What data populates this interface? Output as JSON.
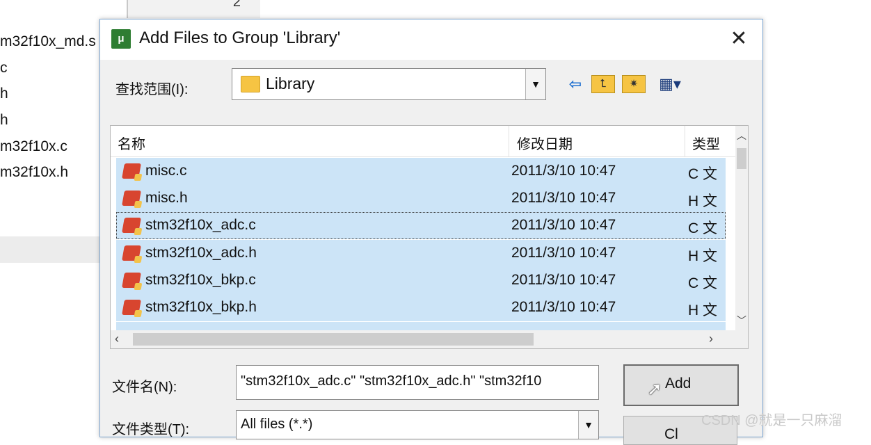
{
  "background": {
    "line_number": "2",
    "items": [
      "m32f10x_md.s",
      "c",
      "h",
      "h",
      "m32f10x.c",
      "m32f10x.h"
    ]
  },
  "dialog": {
    "title": "Add Files to Group 'Library'",
    "close_glyph": "✕",
    "lookin_label": "查找范围(I):",
    "lookin_value": "Library",
    "toolbar": {
      "back_glyph": "⇦",
      "up_glyph": "⮤",
      "new_folder_glyph": "✷",
      "view_glyph": "▦▾"
    },
    "columns": {
      "name": "名称",
      "date": "修改日期",
      "type": "类型"
    },
    "files": [
      {
        "name": "misc.c",
        "date": "2011/3/10 10:47",
        "type": "C 文"
      },
      {
        "name": "misc.h",
        "date": "2011/3/10 10:47",
        "type": "H 文"
      },
      {
        "name": "stm32f10x_adc.c",
        "date": "2011/3/10 10:47",
        "type": "C 文"
      },
      {
        "name": "stm32f10x_adc.h",
        "date": "2011/3/10 10:47",
        "type": "H 文"
      },
      {
        "name": "stm32f10x_bkp.c",
        "date": "2011/3/10 10:47",
        "type": "C 文"
      },
      {
        "name": "stm32f10x_bkp.h",
        "date": "2011/3/10 10:47",
        "type": "H 文"
      }
    ],
    "filename_label": "文件名(N):",
    "filename_value": "\"stm32f10x_adc.c\" \"stm32f10x_adc.h\" \"stm32f10",
    "filetype_label": "文件类型(T):",
    "filetype_value": "All files (*.*)",
    "add_label": "Add",
    "cancel_label": "Cl"
  },
  "watermark": "CSDN @就是一只麻溜"
}
